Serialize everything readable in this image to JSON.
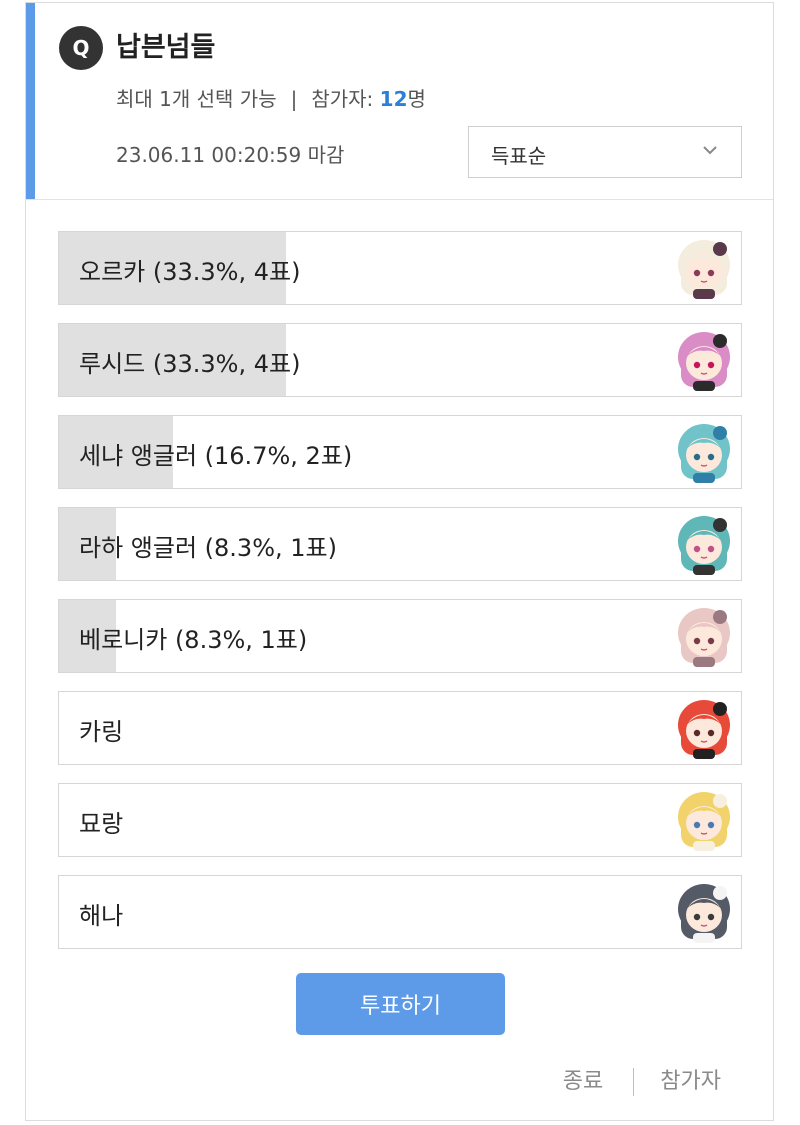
{
  "poll": {
    "badge": "Q",
    "title": "납븐넘들",
    "meta_limit": "최대 1개 선택 가능",
    "meta_sep": "|",
    "meta_participants_label": "참가자:",
    "meta_participants_count": "12",
    "meta_participants_unit": "명",
    "deadline": "23.06.11 00:20:59 마감",
    "sort_selected": "득표순"
  },
  "options": [
    {
      "label": "오르카 (33.3%, 4표)",
      "percent": 33.3,
      "votes": 4,
      "avatar": "orca-avatar-icon"
    },
    {
      "label": "루시드 (33.3%, 4표)",
      "percent": 33.3,
      "votes": 4,
      "avatar": "lucid-avatar-icon"
    },
    {
      "label": "세냐 앵글러 (16.7%, 2표)",
      "percent": 16.7,
      "votes": 2,
      "avatar": "senya-avatar-icon"
    },
    {
      "label": "라하 앵글러 (8.3%, 1표)",
      "percent": 8.3,
      "votes": 1,
      "avatar": "laha-avatar-icon"
    },
    {
      "label": "베로니카 (8.3%, 1표)",
      "percent": 8.3,
      "votes": 1,
      "avatar": "veronica-avatar-icon"
    },
    {
      "label": "카링",
      "percent": 0,
      "votes": 0,
      "avatar": "karing-avatar-icon"
    },
    {
      "label": "묘랑",
      "percent": 0,
      "votes": 0,
      "avatar": "myorang-avatar-icon"
    },
    {
      "label": "해나",
      "percent": 0,
      "votes": 0,
      "avatar": "haena-avatar-icon"
    }
  ],
  "actions": {
    "vote_label": "투표하기",
    "end_label": "종료",
    "participants_label": "참가자"
  },
  "colors": {
    "accent": "#5d9be8",
    "count_blue": "#2a7fd6",
    "bar_fill": "#e0e0e0"
  }
}
